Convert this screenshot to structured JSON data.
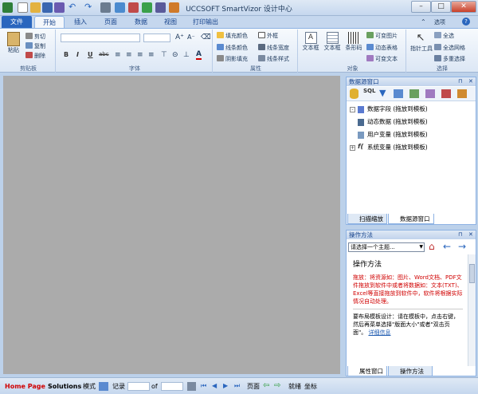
{
  "app": {
    "title": "UCCSOFT SmartVizor 设计中心"
  },
  "tabs": [
    "文件",
    "开始",
    "插入",
    "页面",
    "数据",
    "视图",
    "打印输出"
  ],
  "ribbon_right": {
    "help": "选项"
  },
  "clipboard": {
    "paste": "粘贴",
    "cut": "剪切",
    "copy": "复制",
    "delete": "删除",
    "label": "剪贴板"
  },
  "font": {
    "label": "字体",
    "format_buttons": [
      "B",
      "I",
      "U",
      "abc"
    ]
  },
  "attribute": {
    "fill": "填充颜色",
    "line_color": "线条颜色",
    "shadow": "阴影填充",
    "outer_frame": "外框",
    "line_width": "线条宽度",
    "line_style": "线条样式",
    "label": "属性"
  },
  "object": {
    "text_frame": "文本框",
    "text_box": "文本框",
    "chart": "条形码",
    "image": "可变图片",
    "dynamic_table": "动态表格",
    "variable_text": "可变文本",
    "label": "对象"
  },
  "select": {
    "pointer": "指针工具",
    "select_all": "全选",
    "select_all_grid": "全选网格",
    "multi_select": "多重选择",
    "label": "选择"
  },
  "datasource": {
    "title": "数据源窗口",
    "items": [
      "数据字段 (拖放到模板)",
      "动态数据 (拖放到模板)",
      "用户变量 (拖放到模板)",
      "系统变量 (拖放到模板)"
    ],
    "tabs": [
      "扫描缩放",
      "数据源窗口"
    ]
  },
  "help": {
    "title": "操作方法",
    "topic_placeholder": "请选择一个主题...",
    "heading": "操作方法",
    "red_text": "拖放：将资源如：图片、Word文档、PDF文件拖放到软件中或者将数据如：文本(TXT)、Excel等直接拖放到软件中，软件将根据实际情况自动处理。",
    "body_text": "要布局模板设计：请在模板中，点击右键，然后再菜单选择\"版面大小\"或者\"双击页面\"。",
    "link": "详细信息",
    "tabs": [
      "属性窗口",
      "操作方法"
    ]
  },
  "status": {
    "home": "Home Page",
    "solutions": "Solutions",
    "mode": "模式",
    "record": "记录",
    "of": "of",
    "page": "页面",
    "ready": "就绪",
    "coord": "坐标"
  },
  "colors": {
    "accent": "#2a66be",
    "red": "#d00000",
    "link": "#1d5ab0"
  }
}
